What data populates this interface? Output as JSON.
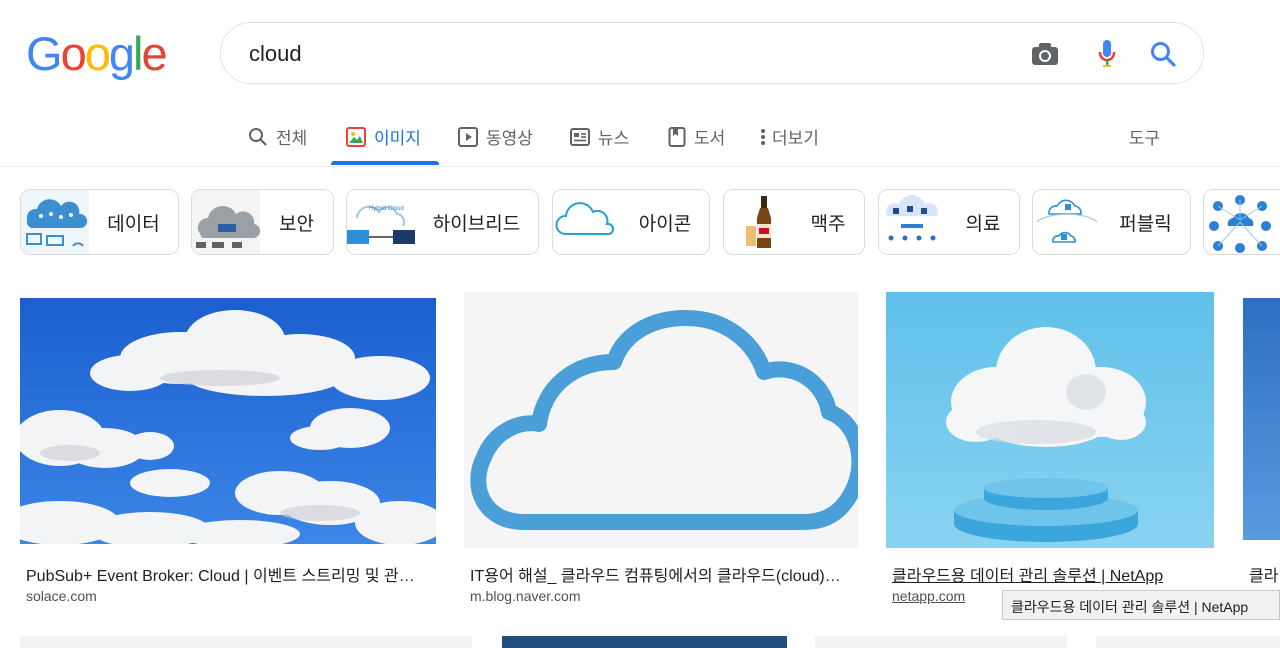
{
  "brand": {
    "letters": [
      "G",
      "o",
      "o",
      "g",
      "l",
      "e"
    ],
    "colors": [
      "#4285F4",
      "#EA4335",
      "#FBBC05",
      "#4285F4",
      "#34A853",
      "#EA4335"
    ]
  },
  "search": {
    "query": "cloud"
  },
  "tabs": [
    {
      "label": "전체",
      "icon": "search-icon"
    },
    {
      "label": "이미지",
      "icon": "image-icon",
      "active": true
    },
    {
      "label": "동영상",
      "icon": "play-icon"
    },
    {
      "label": "뉴스",
      "icon": "news-icon"
    },
    {
      "label": "도서",
      "icon": "book-icon"
    },
    {
      "label": "더보기",
      "icon": "more-vert-icon"
    }
  ],
  "tools_label": "도구",
  "chips": [
    {
      "label": "데이터"
    },
    {
      "label": "보안"
    },
    {
      "label": "하이브리드",
      "thumb_text": "Hybrid Cloud"
    },
    {
      "label": "아이콘"
    },
    {
      "label": "맥주"
    },
    {
      "label": "의료"
    },
    {
      "label": "퍼블릭"
    },
    {
      "label": ""
    }
  ],
  "results": [
    {
      "title": "PubSub+ Event Broker: Cloud | 이벤트 스트리밍 및 관…",
      "site": "solace.com"
    },
    {
      "title": "IT용어 해설_ 클라우드 컴퓨팅에서의 클라우드(cloud)…",
      "site": "m.blog.naver.com"
    },
    {
      "title": "클라우드용 데이터 관리 솔루션 | NetApp",
      "site": "netapp.com"
    },
    {
      "title": "클라",
      "site": ""
    }
  ],
  "tooltip": "클라우드용 데이터 관리 솔루션 | NetApp",
  "colors": {
    "accent": "#1a73e8",
    "sky": "#1e5fd0",
    "cloud_outline": "#4a9fd8",
    "pedestal": "#6ec4ea"
  }
}
